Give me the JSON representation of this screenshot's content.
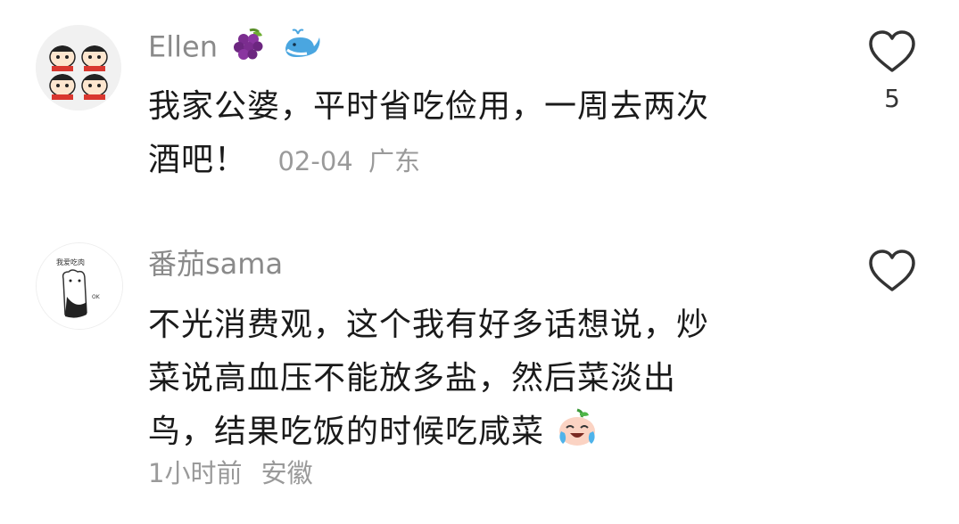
{
  "comments": [
    {
      "username": "Ellen",
      "username_emojis": [
        "grapes-emoji",
        "whale-emoji"
      ],
      "text_line1": "我家公婆，平时省吃俭用，一周去两次",
      "text_line2": "酒吧！",
      "date": "02-04",
      "location": "广东",
      "like_count": "5"
    },
    {
      "username": "番茄sama",
      "text_line1": "不光消费观，这个我有好多话想说，炒",
      "text_line2": "菜说高血压不能放多盐，然后菜淡出",
      "text_line3": "鸟，结果吃饭的时候吃咸菜",
      "time": "1小时前",
      "location": "安徽",
      "like_count": ""
    }
  ]
}
